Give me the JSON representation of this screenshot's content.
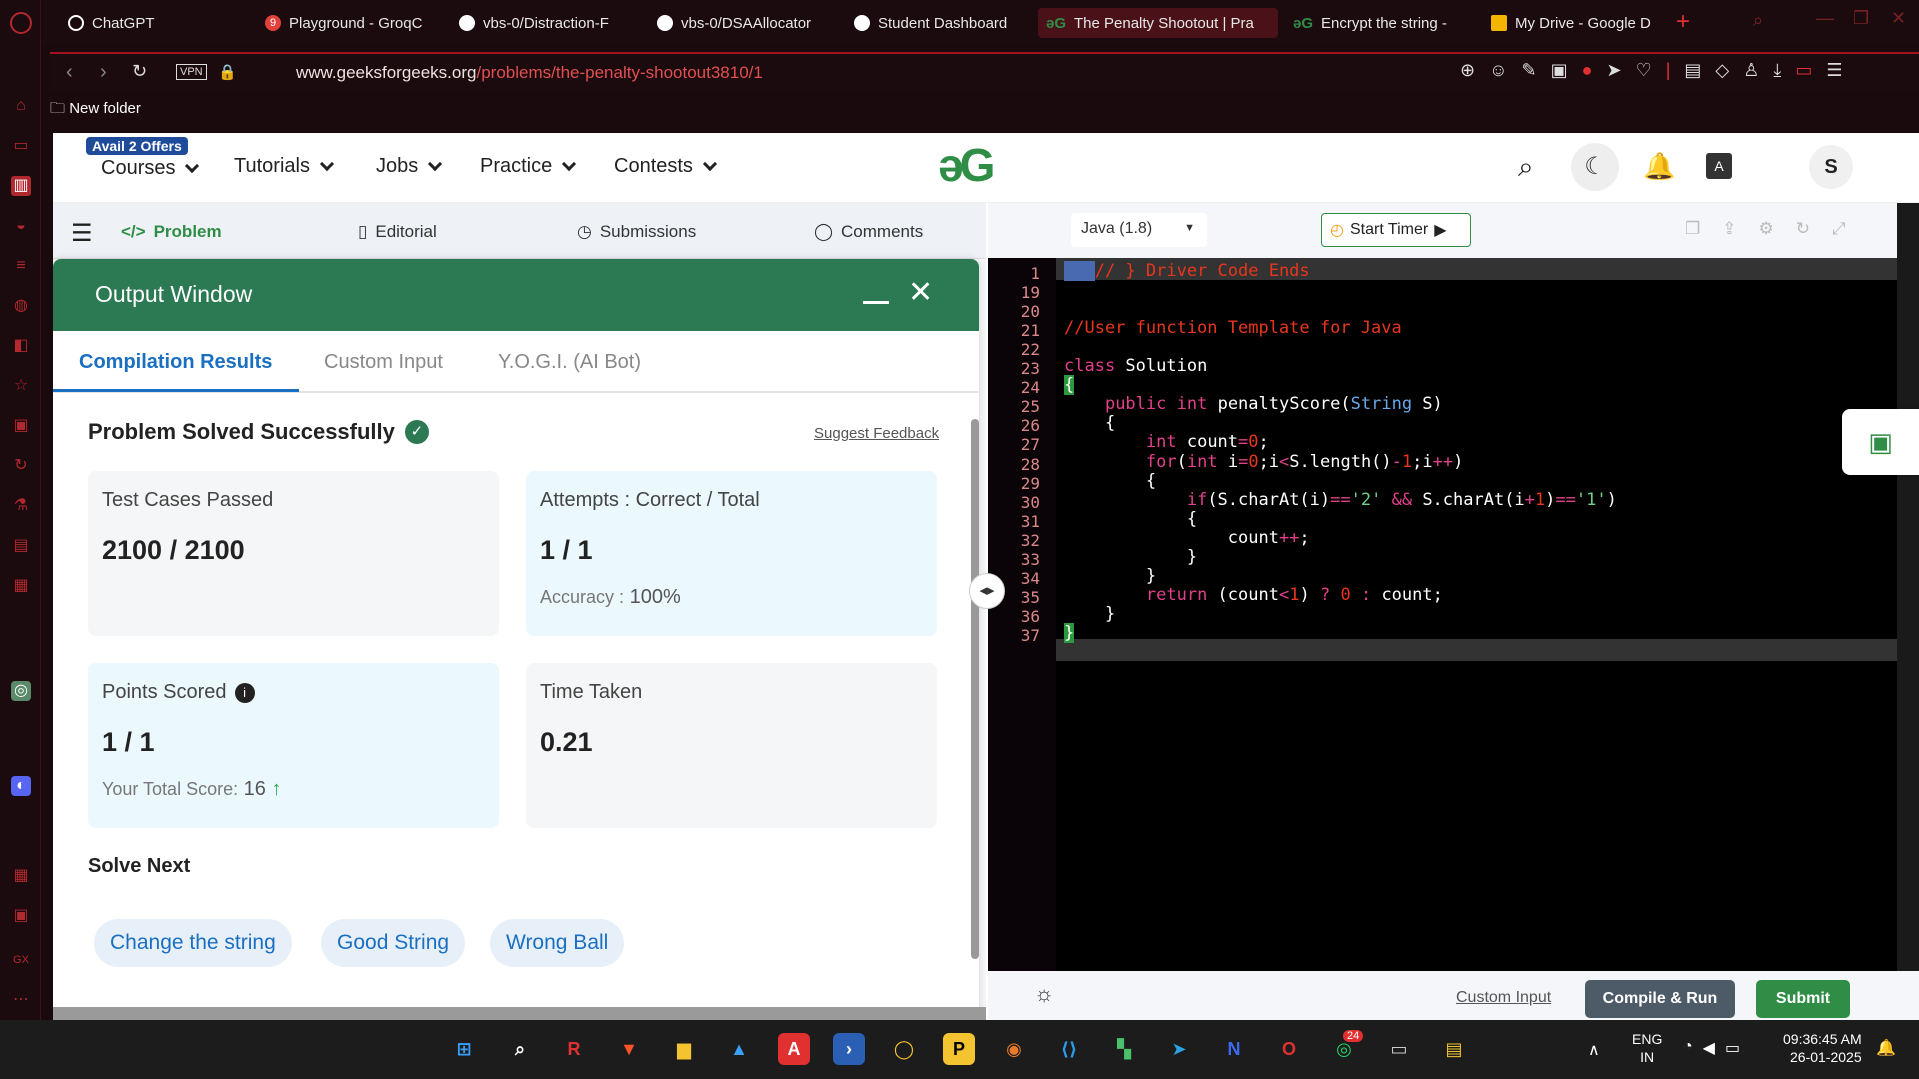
{
  "browser": {
    "tabs": [
      {
        "label": "ChatGPT",
        "color": "#ffffff"
      },
      {
        "label": "Playground - GroqC",
        "color": "#e0413a"
      },
      {
        "label": "vbs-0/Distraction-F",
        "color": "#ffffff"
      },
      {
        "label": "vbs-0/DSAAllocator",
        "color": "#ffffff"
      },
      {
        "label": "Student Dashboard",
        "color": "#ffffff"
      },
      {
        "label": "The Penalty Shootout | Pra",
        "color": "#2f8d46"
      },
      {
        "label": "Encrypt the string -",
        "color": "#2f8d46"
      },
      {
        "label": "My Drive - Google D",
        "color": "#f4b400"
      }
    ],
    "url_host": "www.geeksforgeeks.org",
    "url_path": "/problems/the-penalty-shootout3810/1",
    "vpn_label": "VPN",
    "bookmark": "New folder",
    "tab_badge": "9"
  },
  "gfg": {
    "offer": "Avail 2 Offers",
    "nav": [
      "Courses",
      "Tutorials",
      "Jobs",
      "Practice",
      "Contests"
    ],
    "logo": "ǝG",
    "avatar": "S"
  },
  "problem_tabs": [
    "Problem",
    "Editorial",
    "Submissions",
    "Comments"
  ],
  "output": {
    "title": "Output Window",
    "tabs": [
      "Compilation Results",
      "Custom Input",
      "Y.O.G.I. (AI Bot)"
    ],
    "status": "Problem Solved Successfully",
    "feedback": "Suggest Feedback",
    "test_label": "Test Cases Passed",
    "test_value": "2100 / 2100",
    "attempts_label": "Attempts : Correct / Total",
    "attempts_value": "1 / 1",
    "accuracy_label": "Accuracy :",
    "accuracy_value": "100%",
    "points_label": "Points Scored",
    "points_value": "1 / 1",
    "total_label": "Your Total Score:",
    "total_value": "16",
    "time_label": "Time Taken",
    "time_value": "0.21",
    "solve_next": "Solve Next",
    "chips": [
      "Change the string",
      "Good String",
      "Wrong Ball"
    ]
  },
  "editor": {
    "language": "Java (1.8)",
    "timer": "Start Timer",
    "custom_input": "Custom Input",
    "compile": "Compile & Run",
    "submit": "Submit",
    "line_numbers": [
      "1",
      "19",
      "20",
      "21",
      "22",
      "23",
      "24",
      "25",
      "26",
      "27",
      "28",
      "29",
      "30",
      "31",
      "32",
      "33",
      "34",
      "35",
      "36",
      "37"
    ]
  },
  "taskbar": {
    "lang": "ENG",
    "region": "IN",
    "time": "09:36:45 AM",
    "date": "26-01-2025",
    "badge": "24"
  }
}
